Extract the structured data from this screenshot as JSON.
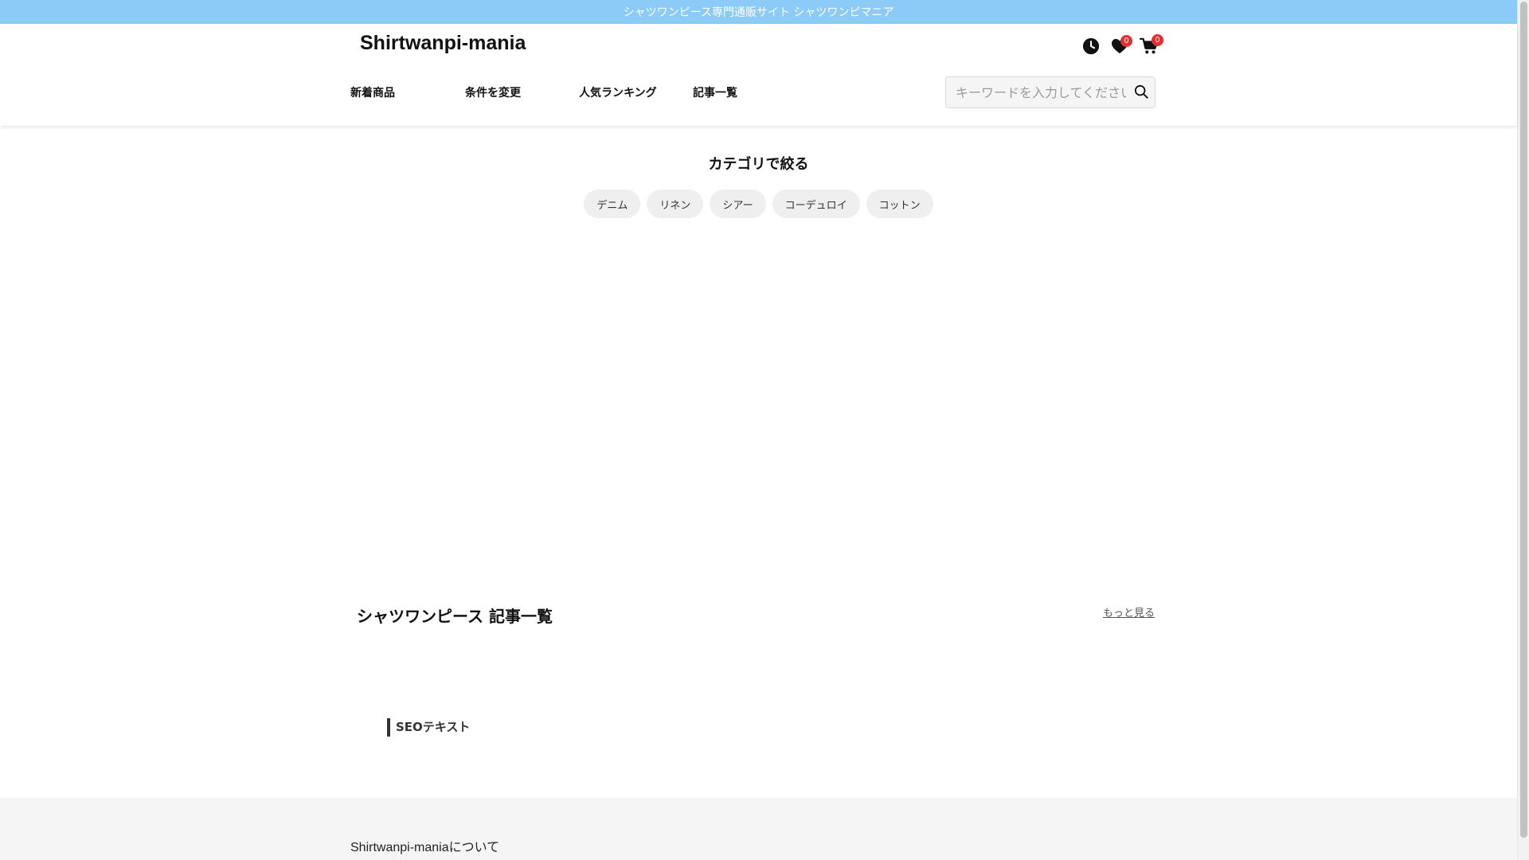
{
  "banner": {
    "text": "シャツワンピース専門通販サイト シャツワンピマニア",
    "color": "#8ccbf7"
  },
  "header": {
    "brand": "Shirtwanpi-mania",
    "icons": {
      "history": "clock-icon",
      "favorites": "heart-icon",
      "cart": "cart-icon"
    },
    "favorites_count": "0",
    "cart_count": "0",
    "badge_color": "#e0302f"
  },
  "nav": {
    "items": [
      {
        "label": "新着商品"
      },
      {
        "label": "条件を変更"
      },
      {
        "label": "人気ランキング"
      },
      {
        "label": "記事一覧"
      }
    ]
  },
  "search": {
    "value": "",
    "placeholder": "キーワードを入力してください",
    "icon": "search-icon"
  },
  "category": {
    "title": "カテゴリで絞る",
    "pills": [
      {
        "label": "デニム"
      },
      {
        "label": "リネン"
      },
      {
        "label": "シアー"
      },
      {
        "label": "コーデュロイ"
      },
      {
        "label": "コットン"
      }
    ]
  },
  "articles": {
    "heading": "シャツワンピース 記事一覧",
    "more_label": "もっと見る"
  },
  "seo": {
    "title": "SEOテキスト"
  },
  "footer": {
    "about": "Shirtwanpi-maniaについて"
  }
}
